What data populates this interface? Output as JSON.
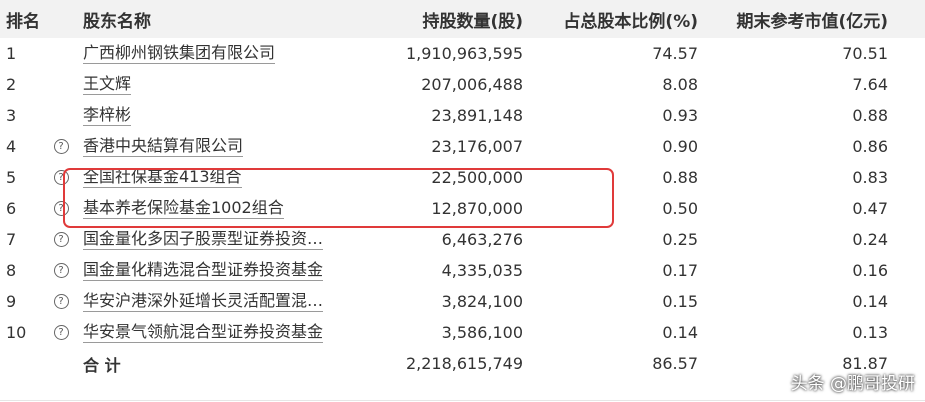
{
  "header": {
    "rank": "排名",
    "name": "股东名称",
    "shares": "持股数量(股)",
    "ratio": "占总股本比例(%)",
    "value": "期末参考市值(亿元)"
  },
  "rows": [
    {
      "rank": "1",
      "name": "广西柳州钢铁集团有限公司",
      "shares": "1,910,963,595",
      "ratio": "74.57",
      "value": "70.51",
      "icon": ""
    },
    {
      "rank": "2",
      "name": "王文辉",
      "shares": "207,006,488",
      "ratio": "8.08",
      "value": "7.64",
      "icon": ""
    },
    {
      "rank": "3",
      "name": "李梓彬",
      "shares": "23,891,148",
      "ratio": "0.93",
      "value": "0.88",
      "icon": ""
    },
    {
      "rank": "4",
      "name": "香港中央結算有限公司",
      "shares": "23,176,007",
      "ratio": "0.90",
      "value": "0.86",
      "icon": "?"
    },
    {
      "rank": "5",
      "name": "全国社保基金413组合",
      "shares": "22,500,000",
      "ratio": "0.88",
      "value": "0.83",
      "icon": "?"
    },
    {
      "rank": "6",
      "name": "基本养老保险基金1002组合",
      "shares": "12,870,000",
      "ratio": "0.50",
      "value": "0.47",
      "icon": "?"
    },
    {
      "rank": "7",
      "name": "国金量化多因子股票型证券投资…",
      "shares": "6,463,276",
      "ratio": "0.25",
      "value": "0.24",
      "icon": "?"
    },
    {
      "rank": "8",
      "name": "国金量化精选混合型证券投资基金",
      "shares": "4,335,035",
      "ratio": "0.17",
      "value": "0.16",
      "icon": "?"
    },
    {
      "rank": "9",
      "name": "华安沪港深外延增长灵活配置混…",
      "shares": "3,824,100",
      "ratio": "0.15",
      "value": "0.14",
      "icon": "?"
    },
    {
      "rank": "10",
      "name": "华安景气领航混合型证券投资基金",
      "shares": "3,586,100",
      "ratio": "0.14",
      "value": "0.13",
      "icon": "?"
    }
  ],
  "total": {
    "label": "合 计",
    "shares": "2,218,615,749",
    "ratio": "86.57",
    "value": "81.87"
  },
  "watermark": "头条 @鹏哥投研",
  "highlight_color": "#e03a3a"
}
